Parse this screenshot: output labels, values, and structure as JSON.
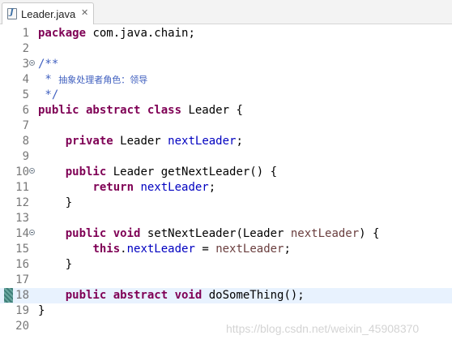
{
  "tab": {
    "icon": "java-file-icon",
    "icon_glyph": "J",
    "label": "Leader.java",
    "close": "✕"
  },
  "editor": {
    "lines": [
      {
        "n": "1"
      },
      {
        "n": "2"
      },
      {
        "n": "3"
      },
      {
        "n": "4"
      },
      {
        "n": "5"
      },
      {
        "n": "6"
      },
      {
        "n": "7"
      },
      {
        "n": "8"
      },
      {
        "n": "9"
      },
      {
        "n": "10"
      },
      {
        "n": "11"
      },
      {
        "n": "12"
      },
      {
        "n": "13"
      },
      {
        "n": "14"
      },
      {
        "n": "15"
      },
      {
        "n": "16"
      },
      {
        "n": "17"
      },
      {
        "n": "18"
      },
      {
        "n": "19"
      },
      {
        "n": "20"
      }
    ],
    "tokens": {
      "l1_kw": "package",
      "l1_rest": " com.java.chain;",
      "l3": "/**",
      "l4_star": " * ",
      "l4_text": "抽象处理者角色：领导",
      "l5": " */",
      "l6_kw": "public abstract class",
      "l6_rest": " Leader {",
      "l8_kw": "private",
      "l8_type": " Leader ",
      "l8_field": "nextLeader",
      "l8_end": ";",
      "l10_kw": "public",
      "l10_rest": " Leader getNextLeader() {",
      "l11_kw": "return",
      "l11_field": "nextLeader",
      "l11_end": ";",
      "l12": "}",
      "l14_kw": "public void",
      "l14_rest": " setNextLeader(Leader ",
      "l14_param": "nextLeader",
      "l14_end": ") {",
      "l15_kw": "this",
      "l15_dot": ".",
      "l15_field": "nextLeader",
      "l15_eq": " = ",
      "l15_param": "nextLeader",
      "l15_end": ";",
      "l16": "}",
      "l18_kw": "public abstract void",
      "l18_rest": " doSomeThing();",
      "l19": "}"
    }
  },
  "watermark": "https://blog.csdn.net/weixin_45908370",
  "colors": {
    "keyword": "#7f0055",
    "field": "#0000c0",
    "comment": "#3f5fbf",
    "current_line": "#e8f2fe"
  }
}
